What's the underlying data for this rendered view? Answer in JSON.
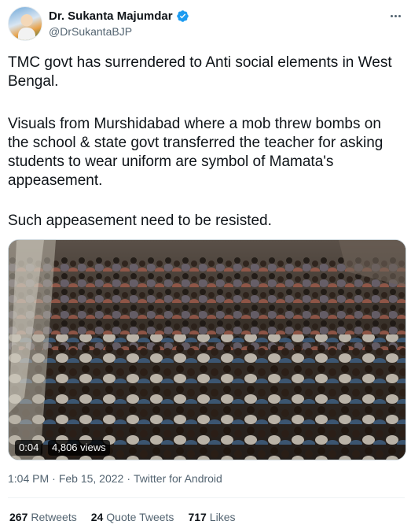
{
  "user": {
    "display_name": "Dr. Sukanta Majumdar",
    "handle": "@DrSukantaBJP",
    "verified": true
  },
  "tweet": {
    "paragraphs": [
      "TMC govt has surrendered to Anti social elements in West Bengal.",
      "Visuals from Murshidabad where a mob threw bombs on the school & state govt transferred the teacher for asking students to wear uniform are symbol of Mamata's appeasement.",
      "Such appeasement need to be resisted."
    ]
  },
  "media": {
    "type": "video",
    "duration": "0:04",
    "views": "4,806 views"
  },
  "meta": {
    "time": "1:04 PM",
    "date": "Feb 15, 2022",
    "source": "Twitter for Android",
    "separator": "·"
  },
  "stats": {
    "retweets_count": "267",
    "retweets_label": "Retweets",
    "quotes_count": "24",
    "quotes_label": "Quote Tweets",
    "likes_count": "717",
    "likes_label": "Likes"
  },
  "colors": {
    "verified_blue": "#1d9bf0",
    "text_primary": "#0f1419",
    "text_secondary": "#536471"
  },
  "icons": {
    "verified": "verified-badge-icon",
    "more": "more-options-icon"
  }
}
